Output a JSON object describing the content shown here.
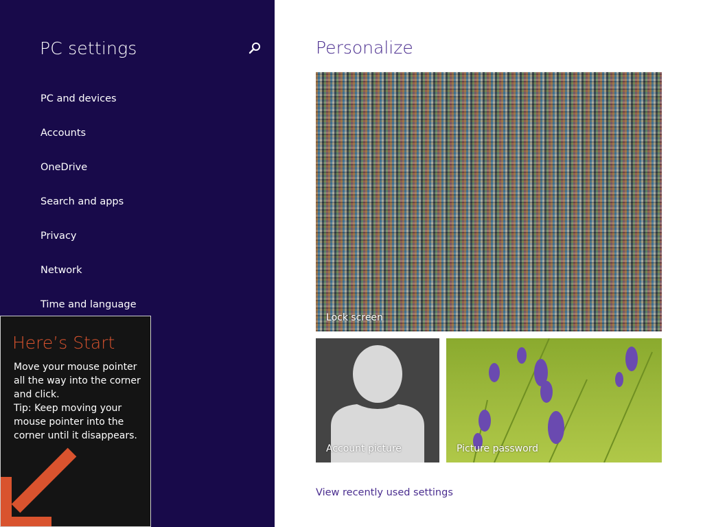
{
  "sidebar": {
    "title": "PC settings",
    "search_icon": "search-icon",
    "items": [
      {
        "label": "PC and devices"
      },
      {
        "label": "Accounts"
      },
      {
        "label": "OneDrive"
      },
      {
        "label": "Search and apps"
      },
      {
        "label": "Privacy"
      },
      {
        "label": "Network"
      },
      {
        "label": "Time and language"
      }
    ],
    "background_color": "#180a4a"
  },
  "tip": {
    "title": "Here’s Start",
    "lines": [
      "Move your mouse pointer",
      "all the way into the corner",
      "and click.",
      "Tip: Keep moving your",
      "mouse pointer into the",
      "corner until it disappears."
    ],
    "accent_color": "#d9532e",
    "arrow_icon": "arrow-down-left-icon"
  },
  "main": {
    "title": "Personalize",
    "tiles": {
      "lock_screen": {
        "label": "Lock screen"
      },
      "account_picture": {
        "label": "Account picture"
      },
      "picture_password": {
        "label": "Picture password"
      }
    },
    "recent_link": "View recently used settings",
    "accent_color": "#4a2d8f"
  }
}
